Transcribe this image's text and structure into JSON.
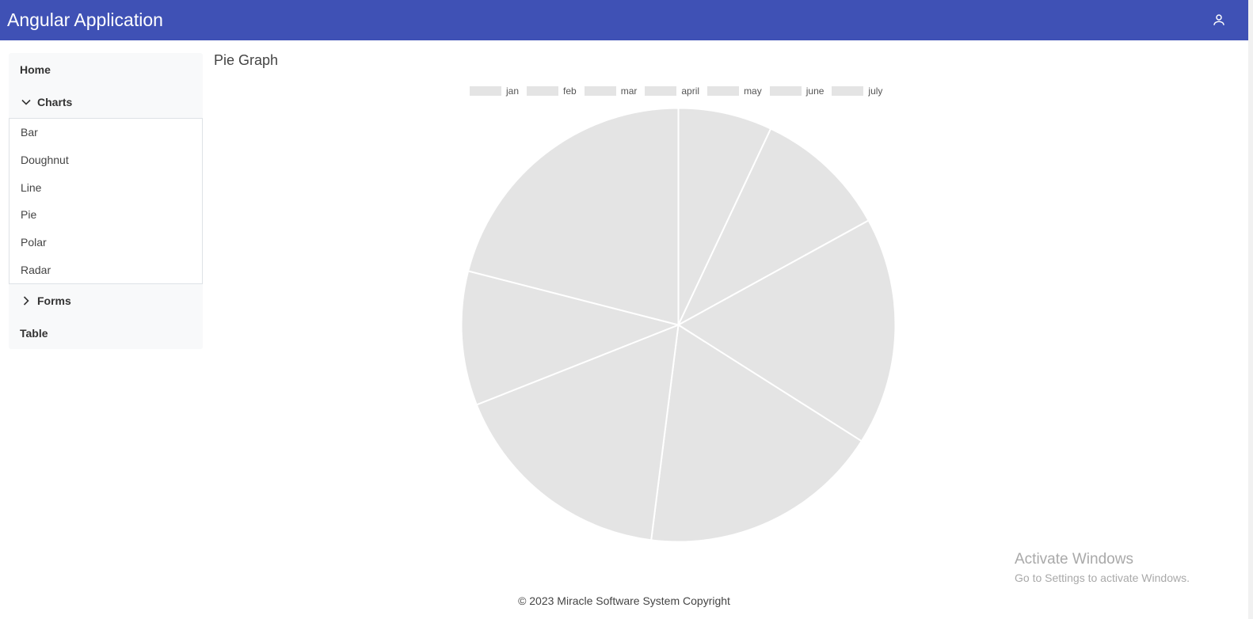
{
  "header": {
    "title": "Angular Application",
    "user_icon": "user-icon"
  },
  "sidebar": {
    "home": "Home",
    "charts": {
      "label": "Charts",
      "expanded": true,
      "items": [
        "Bar",
        "Doughnut",
        "Line",
        "Pie",
        "Polar",
        "Radar"
      ]
    },
    "forms": {
      "label": "Forms",
      "expanded": false
    },
    "table": "Table"
  },
  "page": {
    "title": "Pie Graph"
  },
  "chart_data": {
    "type": "pie",
    "categories": [
      "jan",
      "feb",
      "mar",
      "april",
      "may",
      "june",
      "july"
    ],
    "values": [
      7,
      10,
      17,
      18,
      17,
      10,
      21
    ],
    "colors": [
      "#e4e4e4",
      "#e4e4e4",
      "#e4e4e4",
      "#e4e4e4",
      "#e4e4e4",
      "#e4e4e4",
      "#e4e4e4"
    ],
    "legend_position": "top"
  },
  "footer": {
    "text": "© 2023 Miracle Software System Copyright"
  },
  "watermark": {
    "title": "Activate Windows",
    "subtitle": "Go to Settings to activate Windows."
  }
}
